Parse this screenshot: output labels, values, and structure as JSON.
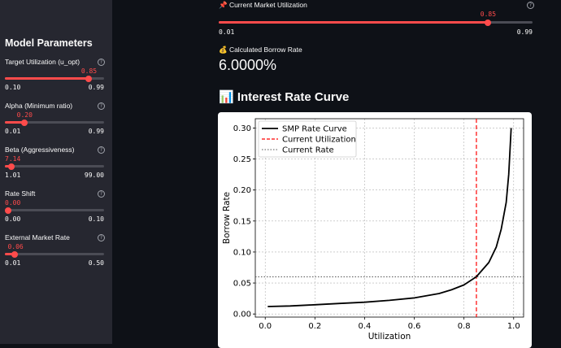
{
  "sidebar": {
    "title": "Model Parameters",
    "sliders": [
      {
        "label": "Target Utilization (u_opt)",
        "value": "0.85",
        "min": "0.10",
        "max": "0.99",
        "fraction": 0.843
      },
      {
        "label": "Alpha (Minimum ratio)",
        "value": "0.20",
        "min": "0.01",
        "max": "0.99",
        "fraction": 0.194
      },
      {
        "label": "Beta (Aggressiveness)",
        "value": "7.14",
        "min": "1.01",
        "max": "99.00",
        "fraction": 0.063
      },
      {
        "label": "Rate Shift",
        "value": "0.00",
        "min": "0.00",
        "max": "0.10",
        "fraction": 0.0
      },
      {
        "label": "External Market Rate",
        "value": "0.06",
        "min": "0.01",
        "max": "0.50",
        "fraction": 0.102
      }
    ]
  },
  "main": {
    "utilization": {
      "icon": "pushpin-icon",
      "label": "📌 Current Market Utilization",
      "value": "0.85",
      "min": "0.01",
      "max": "0.99",
      "fraction": 0.857
    },
    "borrow_rate": {
      "icon": "money-bag-icon",
      "label": "💰 Calculated Borrow Rate",
      "value": "6.0000%"
    },
    "section_title": "📊 Interest Rate Curve"
  },
  "colors": {
    "accent": "#ff4b4b",
    "background": "#0e1117",
    "sidebar": "#262730"
  },
  "chart_data": {
    "type": "line",
    "xlabel": "Utilization",
    "ylabel": "Borrow Rate",
    "xlim": [
      -0.04,
      1.04
    ],
    "ylim": [
      -0.005,
      0.315
    ],
    "xticks": [
      "0.0",
      "0.2",
      "0.4",
      "0.6",
      "0.8",
      "1.0"
    ],
    "yticks": [
      "0.00",
      "0.05",
      "0.10",
      "0.15",
      "0.20",
      "0.25",
      "0.30"
    ],
    "grid": true,
    "legend": "top-left",
    "series": [
      {
        "name": "SMP Rate Curve",
        "style": "solid",
        "color": "#000000",
        "x": [
          0.01,
          0.1,
          0.2,
          0.3,
          0.4,
          0.5,
          0.6,
          0.7,
          0.75,
          0.8,
          0.85,
          0.9,
          0.93,
          0.95,
          0.97,
          0.98,
          0.99
        ],
        "y": [
          0.012,
          0.013,
          0.015,
          0.017,
          0.019,
          0.022,
          0.026,
          0.033,
          0.039,
          0.047,
          0.06,
          0.083,
          0.108,
          0.137,
          0.18,
          0.225,
          0.3
        ]
      },
      {
        "name": "Current Utilization",
        "style": "dashed",
        "color": "#ff0000",
        "x_value": 0.85
      },
      {
        "name": "Current Rate",
        "style": "dotted",
        "color": "#555555",
        "y_value": 0.06
      }
    ]
  }
}
